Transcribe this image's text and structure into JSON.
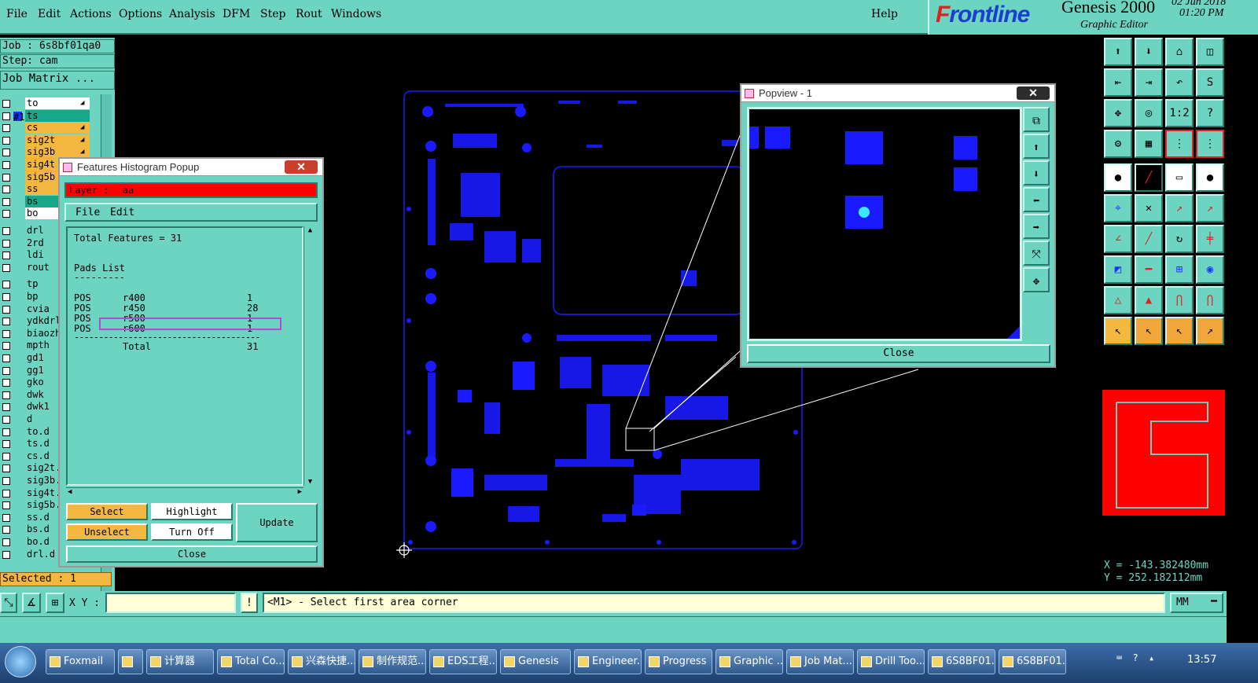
{
  "menu": [
    "File",
    "Edit",
    "Actions",
    "Options",
    "Analysis",
    "DFM",
    "Step",
    "Rout",
    "Windows"
  ],
  "help": "Help",
  "brand": {
    "logo_f": "F",
    "logo_rest": "rontline",
    "product": "Genesis 2000",
    "subtitle": "Graphic Editor",
    "date": "02 Jun 2018",
    "time": "01:20 PM"
  },
  "job": {
    "job_line": "Job : 6s8bf01qa0",
    "step_line": "Step: cam",
    "matrix_button": "Job Matrix ..."
  },
  "layers": [
    {
      "name": "to",
      "color": "#ffffff",
      "sq": "",
      "flag": "◢"
    },
    {
      "name": "ts",
      "color": "#17a889",
      "sq": "#1a33ff",
      "flag": ""
    },
    {
      "name": "cs",
      "color": "#f4b840",
      "sq": "",
      "flag": "◢"
    },
    {
      "name": "sig2t",
      "color": "#f4b840",
      "sq": "",
      "flag": "◢"
    },
    {
      "name": "sig3b",
      "color": "#f4b840",
      "sq": "",
      "flag": "◢"
    },
    {
      "name": "sig4t",
      "color": "#f4b840",
      "sq": "",
      "flag": "◢"
    },
    {
      "name": "sig5b",
      "color": "#f4b840",
      "sq": "",
      "flag": "◢"
    },
    {
      "name": "ss",
      "color": "#f4b840",
      "sq": "",
      "flag": ""
    },
    {
      "name": "bs",
      "color": "#17a889",
      "sq": "",
      "flag": ""
    },
    {
      "name": "bo",
      "color": "#ffffff",
      "sq": "",
      "flag": ""
    },
    {
      "name": "drl",
      "color": "#6cd4c0",
      "sq": "",
      "flag": ""
    },
    {
      "name": "2rd",
      "color": "#6cd4c0",
      "sq": "",
      "flag": ""
    },
    {
      "name": "ldi",
      "color": "#6cd4c0",
      "sq": "",
      "flag": ""
    },
    {
      "name": "rout",
      "color": "#6cd4c0",
      "sq": "",
      "flag": ""
    },
    {
      "name": "tp",
      "color": "#6cd4c0",
      "sq": "",
      "flag": ""
    },
    {
      "name": "bp",
      "color": "#6cd4c0",
      "sq": "",
      "flag": ""
    },
    {
      "name": "cvia",
      "color": "#6cd4c0",
      "sq": "",
      "flag": ""
    },
    {
      "name": "ydkdrl",
      "color": "#6cd4c0",
      "sq": "",
      "flag": ""
    },
    {
      "name": "biaozh",
      "color": "#6cd4c0",
      "sq": "",
      "flag": ""
    },
    {
      "name": "mpth",
      "color": "#6cd4c0",
      "sq": "",
      "flag": ""
    },
    {
      "name": "gd1",
      "color": "#6cd4c0",
      "sq": "",
      "flag": ""
    },
    {
      "name": "gg1",
      "color": "#6cd4c0",
      "sq": "",
      "flag": ""
    },
    {
      "name": "gko",
      "color": "#6cd4c0",
      "sq": "",
      "flag": ""
    },
    {
      "name": "dwk",
      "color": "#6cd4c0",
      "sq": "",
      "flag": ""
    },
    {
      "name": "dwk1",
      "color": "#6cd4c0",
      "sq": "",
      "flag": ""
    },
    {
      "name": "d",
      "color": "#6cd4c0",
      "sq": "",
      "flag": ""
    },
    {
      "name": "to.d",
      "color": "#6cd4c0",
      "sq": "",
      "flag": ""
    },
    {
      "name": "ts.d",
      "color": "#6cd4c0",
      "sq": "",
      "flag": ""
    },
    {
      "name": "cs.d",
      "color": "#6cd4c0",
      "sq": "",
      "flag": ""
    },
    {
      "name": "sig2t.",
      "color": "#6cd4c0",
      "sq": "",
      "flag": ""
    },
    {
      "name": "sig3b.",
      "color": "#6cd4c0",
      "sq": "",
      "flag": ""
    },
    {
      "name": "sig4t.",
      "color": "#6cd4c0",
      "sq": "",
      "flag": ""
    },
    {
      "name": "sig5b.",
      "color": "#6cd4c0",
      "sq": "",
      "flag": ""
    },
    {
      "name": "ss.d",
      "color": "#6cd4c0",
      "sq": "",
      "flag": ""
    },
    {
      "name": "bs.d",
      "color": "#6cd4c0",
      "sq": "",
      "flag": ""
    },
    {
      "name": "bo.d",
      "color": "#6cd4c0",
      "sq": "",
      "flag": ""
    },
    {
      "name": "drl.d",
      "color": "#6cd4c0",
      "sq": "",
      "flag": ""
    }
  ],
  "selected": "Selected : 1",
  "histogram": {
    "title": "Features Histogram Popup",
    "layer_label": "Layer :",
    "layer_value": "aa",
    "menu_file": "File",
    "menu_edit": "Edit",
    "total_line": "Total Features = 31",
    "pads_heading": "Pads List",
    "pads_underline": "---------",
    "rows": [
      {
        "pol": "POS",
        "sym": "r400",
        "count": "1"
      },
      {
        "pol": "POS",
        "sym": "r450",
        "count": "28"
      },
      {
        "pol": "POS",
        "sym": "r500",
        "count": "1"
      },
      {
        "pol": "POS",
        "sym": "r600",
        "count": "1"
      }
    ],
    "separator": "--------------------------------------",
    "total_label": "Total",
    "total_value": "31",
    "btn_select": "Select",
    "btn_highlight": "Highlight",
    "btn_update": "Update",
    "btn_unselect": "Unselect",
    "btn_turnoff": "Turn Off",
    "btn_close": "Close"
  },
  "popview": {
    "title": "Popview - 1",
    "close": "Close"
  },
  "coords": {
    "x": "X = -143.382480mm",
    "y": "Y = 252.182112mm"
  },
  "cmd": {
    "xy_label": "X Y :",
    "input_value": "",
    "bang": "!",
    "prompt": "<M1> - Select first area corner",
    "units": "MM"
  },
  "taskbar": {
    "start": "",
    "items": [
      "Foxmail",
      "",
      "计算器",
      "Total Co...",
      "兴森快捷...",
      "制作规范...",
      "EDS工程...",
      "Genesis",
      "Engineer...",
      "Progress",
      "Graphic ...",
      "Job Mat...",
      "Drill Too...",
      "6S8BF01...",
      "6S8BF01..."
    ],
    "clock": "13:57"
  },
  "colors": {
    "teal": "#6cd4c0",
    "copper": "#1a1aff",
    "layer_red": "#ff0000"
  }
}
